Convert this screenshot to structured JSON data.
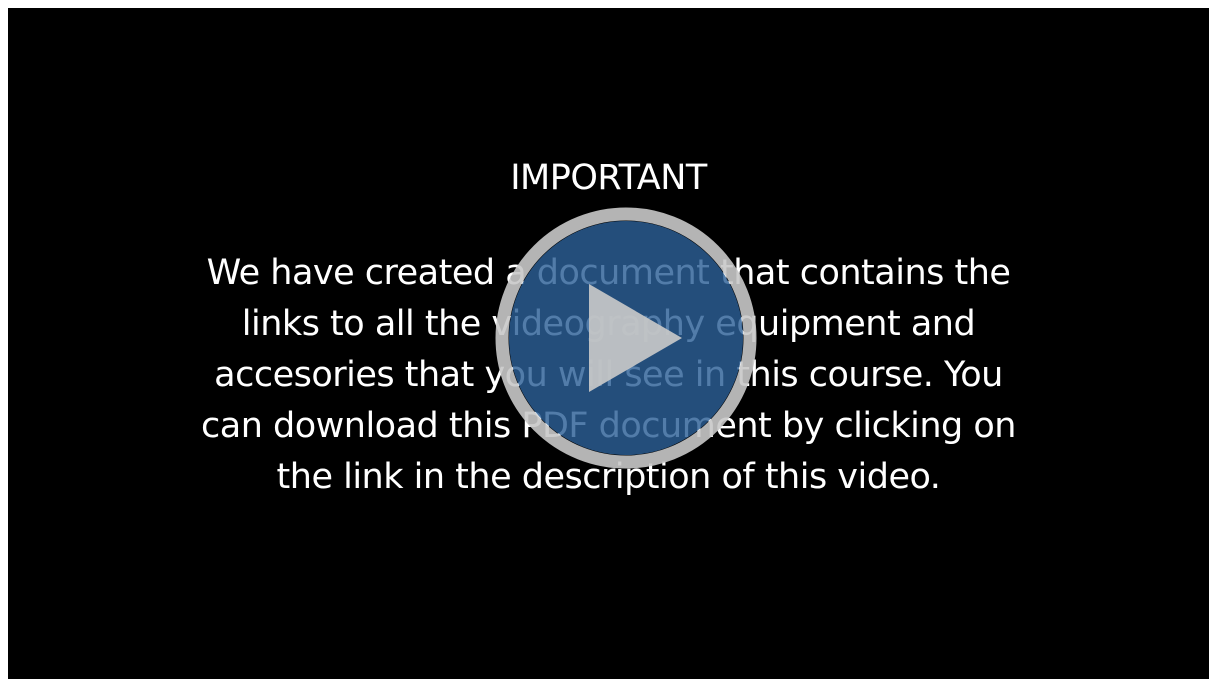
{
  "slide": {
    "heading": "IMPORTANT",
    "lines": [
      "We have created a document that contains the",
      "links to all the videography equipment and",
      "accesories that you will see in this course. You",
      "can download this PDF document by clicking on",
      "the link in the description of this video."
    ]
  },
  "play_button": {
    "icon": "play-icon",
    "fill_color": "#2c5f96",
    "ring_color": "#c8c8c8"
  },
  "colors": {
    "background": "#000000",
    "text": "#ffffff"
  }
}
